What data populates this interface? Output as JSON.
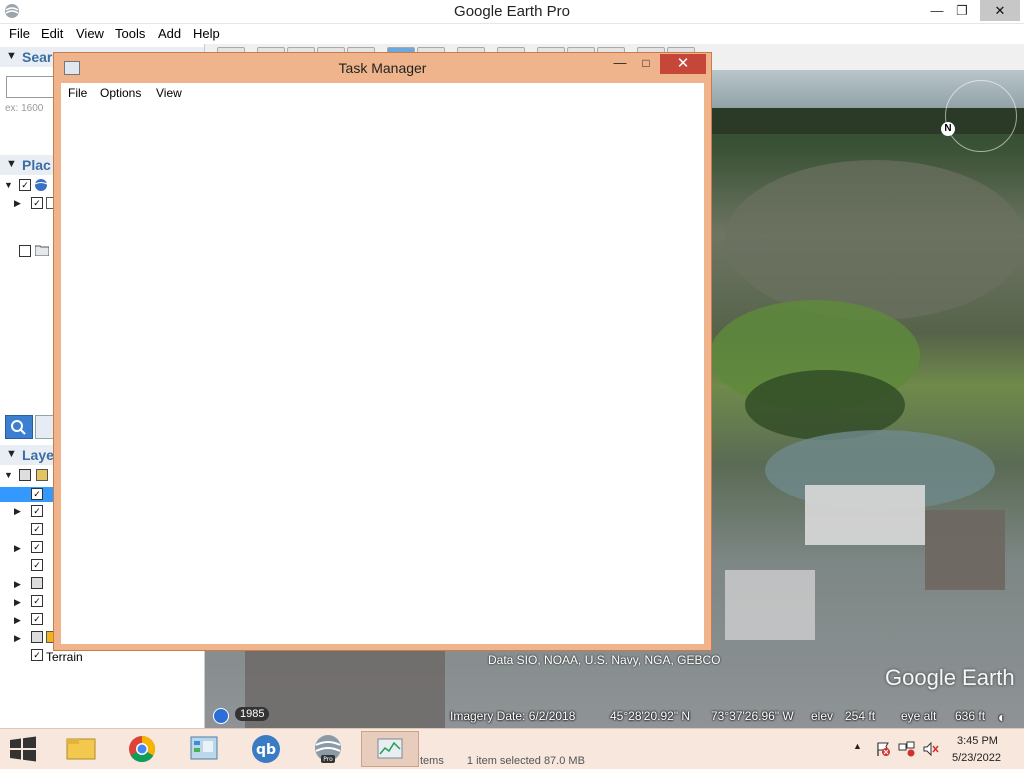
{
  "earth": {
    "title": "Google Earth Pro",
    "menu": [
      "File",
      "Edit",
      "View",
      "Tools",
      "Add",
      "Help"
    ],
    "sidebar": {
      "search_label": "Searc",
      "search_hint": "ex: 1600",
      "places_label": "Plac",
      "layers_label": "Laye",
      "terrain_label": "Terrain"
    },
    "attribution": "Data SIO, NOAA, U.S. Navy, NGA, GEBCO",
    "logo": "Google Earth",
    "status": {
      "history_year": "1985",
      "imagery_date": "Imagery Date: 6/2/2018",
      "latitude": "45°28'20.92\" N",
      "longitude": "73°37'26.96\" W",
      "elev_label": "elev",
      "elev_value": "254 ft",
      "eye_alt_label": "eye alt",
      "eye_alt_value": "636 ft"
    }
  },
  "task_manager": {
    "title": "Task Manager",
    "menu": [
      "File",
      "Options",
      "View"
    ]
  },
  "taskbar": {
    "apps": [
      "start",
      "file-explorer",
      "chrome",
      "control-panel",
      "qbittorrent",
      "google-earth-pro",
      "task-manager"
    ],
    "explorer_status_left": "tems",
    "explorer_status": "1 item selected  87.0 MB",
    "clock_time": "3:45 PM",
    "clock_date": "5/23/2022"
  },
  "colors": {
    "tm_frame": "#f0b48c",
    "tm_close": "#c7463a",
    "taskbar": "#f7e7dc",
    "selection": "#3399ff"
  }
}
